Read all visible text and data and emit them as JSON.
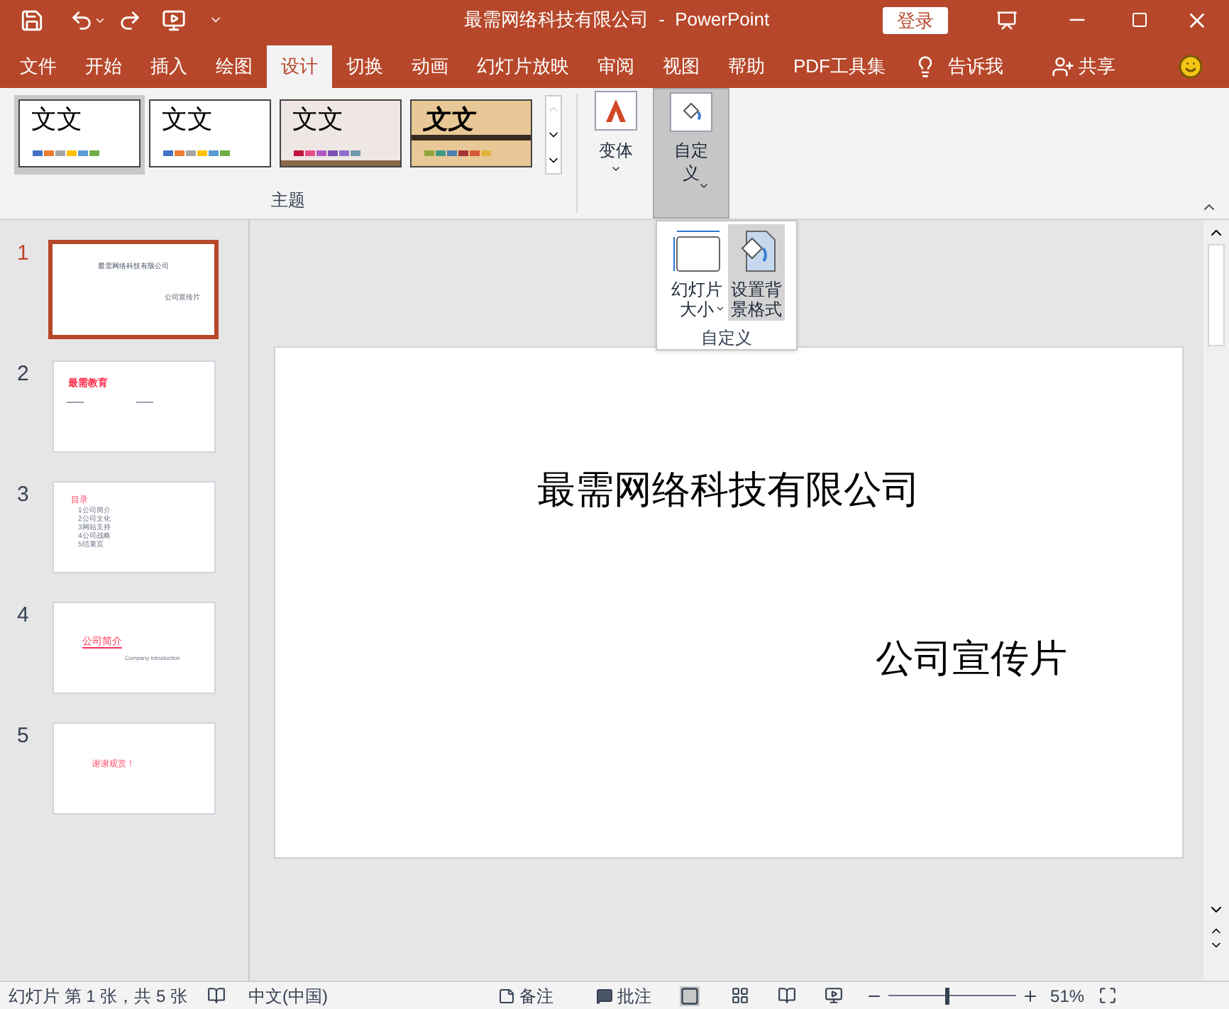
{
  "window": {
    "title": "最需网络科技有限公司  -  PowerPoint",
    "login": "登录"
  },
  "tabs": [
    {
      "label": "文件",
      "selected": false
    },
    {
      "label": "开始",
      "selected": false
    },
    {
      "label": "插入",
      "selected": false
    },
    {
      "label": "绘图",
      "selected": false
    },
    {
      "label": "设计",
      "selected": true
    },
    {
      "label": "切换",
      "selected": false
    },
    {
      "label": "动画",
      "selected": false
    },
    {
      "label": "幻灯片放映",
      "selected": false
    },
    {
      "label": "审阅",
      "selected": false
    },
    {
      "label": "视图",
      "selected": false
    },
    {
      "label": "帮助",
      "selected": false
    },
    {
      "label": "PDF工具集",
      "selected": false
    }
  ],
  "tell_me": "告诉我",
  "share": "共享",
  "ribbon": {
    "themes": [
      {
        "label": "文文",
        "kind": "plain",
        "selected": true
      },
      {
        "label": "文文",
        "kind": "plain",
        "selected": false
      },
      {
        "label": "文文",
        "kind": "paper",
        "selected": false
      },
      {
        "label": "文文",
        "kind": "wood",
        "selected": false
      }
    ],
    "themes_label": "主题",
    "variants": "变体",
    "customize": {
      "label": "自定义",
      "expanded": true
    }
  },
  "popup": {
    "items": [
      {
        "label": "幻灯片大小",
        "kind": "size",
        "selected": false
      },
      {
        "label": "设置背景格式",
        "kind": "background",
        "selected": true
      }
    ],
    "group_label": "自定义"
  },
  "slides": [
    {
      "number": "1",
      "kind": "title",
      "selected": true,
      "texts": [
        "最需网络科技有限公司",
        "公司宣传片"
      ]
    },
    {
      "number": "2",
      "kind": "heading",
      "selected": false,
      "texts": [
        "最需教育"
      ]
    },
    {
      "number": "3",
      "kind": "toc",
      "selected": false,
      "texts": [
        "目录",
        "1公司简介",
        "2公司文化",
        "3网站支持",
        "4公司战略",
        "5结束页"
      ]
    },
    {
      "number": "4",
      "kind": "section",
      "selected": false,
      "texts": [
        "公司简介",
        "Company introduction"
      ]
    },
    {
      "number": "5",
      "kind": "end",
      "selected": false,
      "texts": [
        "谢谢观赏！"
      ]
    }
  ],
  "current_slide": {
    "title": "最需网络科技有限公司",
    "subtitle": "公司宣传片"
  },
  "status_bar": {
    "slide_count": "幻灯片 第 1 张，共 5 张",
    "language": "中文(中国)",
    "notes": "备注",
    "comments": "批注",
    "zoom": "51%",
    "zoom_slider": {
      "level": 0.45
    }
  }
}
